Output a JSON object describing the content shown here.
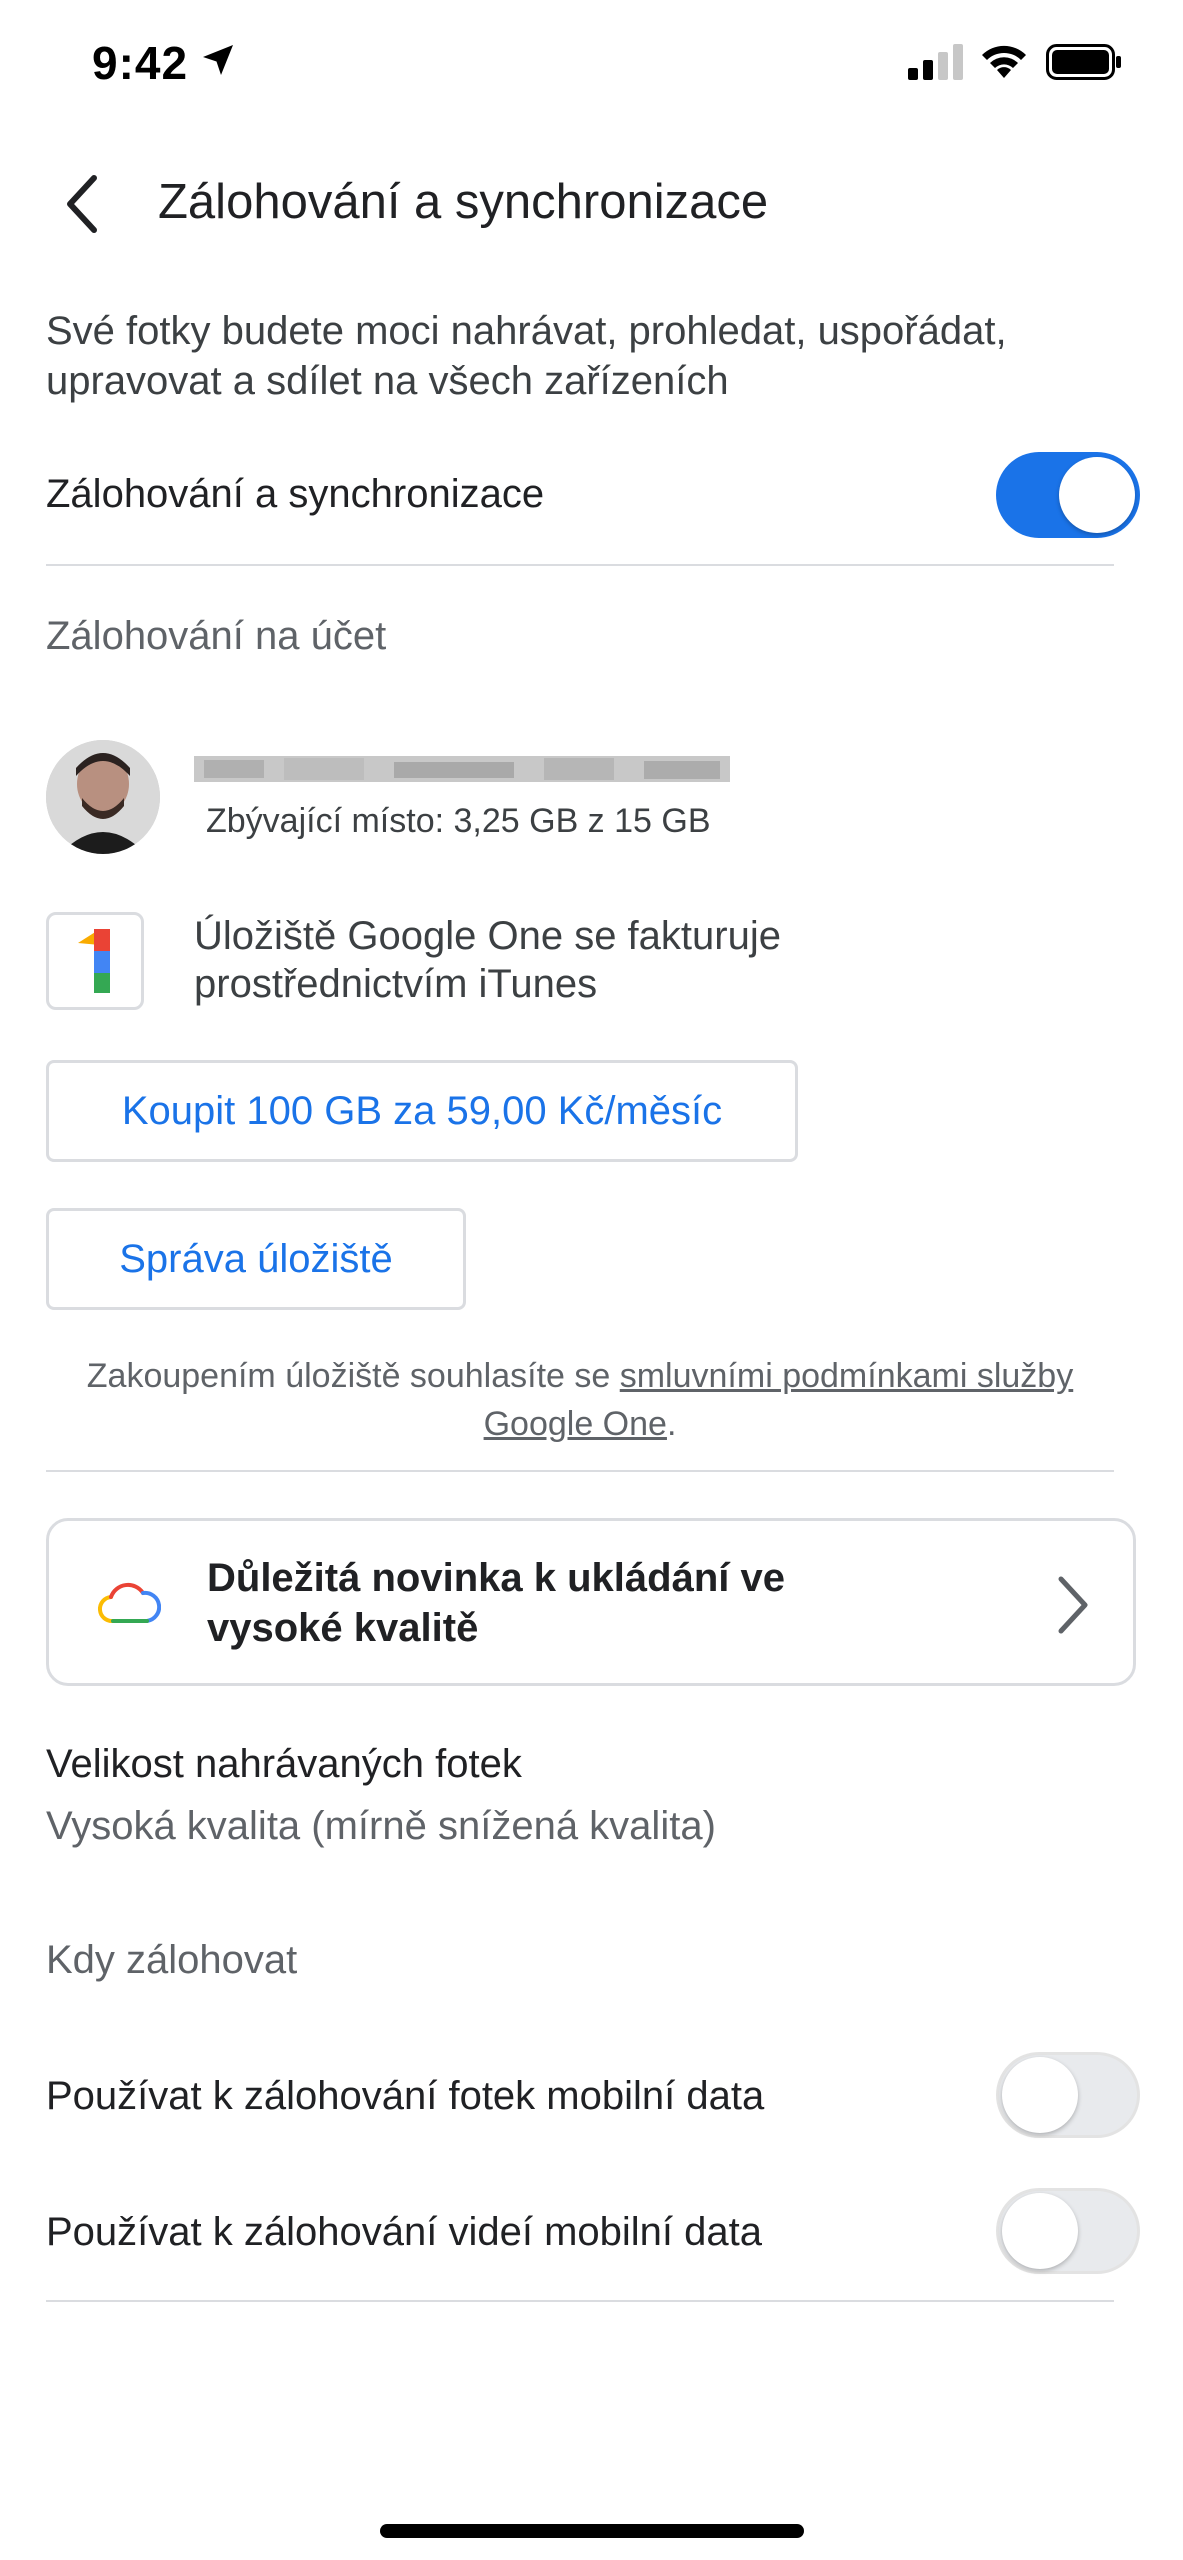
{
  "status_bar": {
    "time": "9:42"
  },
  "header": {
    "title": "Zálohování a synchronizace"
  },
  "description": "Své fotky budete moci nahrávat, prohledat, uspořádat, upravovat a sdílet na všech zařízeních",
  "backup_sync": {
    "label": "Zálohování a synchronizace",
    "enabled": true
  },
  "account_section": {
    "label": "Zálohování na účet",
    "storage_left": "Zbývající místo: 3,25 GB z 15 GB"
  },
  "google_one": {
    "text": "Úložiště Google One se fakturuje prostřednictvím iTunes"
  },
  "buttons": {
    "buy": "Koupit 100 GB za 59,00 Kč/měsíc",
    "manage": "Správa úložiště"
  },
  "terms": {
    "prefix": "Zakoupením úložiště souhlasíte se ",
    "link": "smluvními podmínkami služby Google One",
    "suffix": "."
  },
  "news": {
    "text": "Důležitá novinka k ukládání ve vysoké kvalitě"
  },
  "upload_size": {
    "title": "Velikost nahrávaných fotek",
    "value": "Vysoká kvalita (mírně snížená kvalita)"
  },
  "when_backup": {
    "label": "Kdy zálohovat",
    "photos_mobile_data": {
      "label": "Používat k zálohování fotek mobilní data",
      "enabled": false
    },
    "videos_mobile_data": {
      "label": "Používat k zálohování videí mobilní data",
      "enabled": false
    }
  },
  "colors": {
    "accent": "#1a73e8",
    "divider": "#dadce0"
  }
}
